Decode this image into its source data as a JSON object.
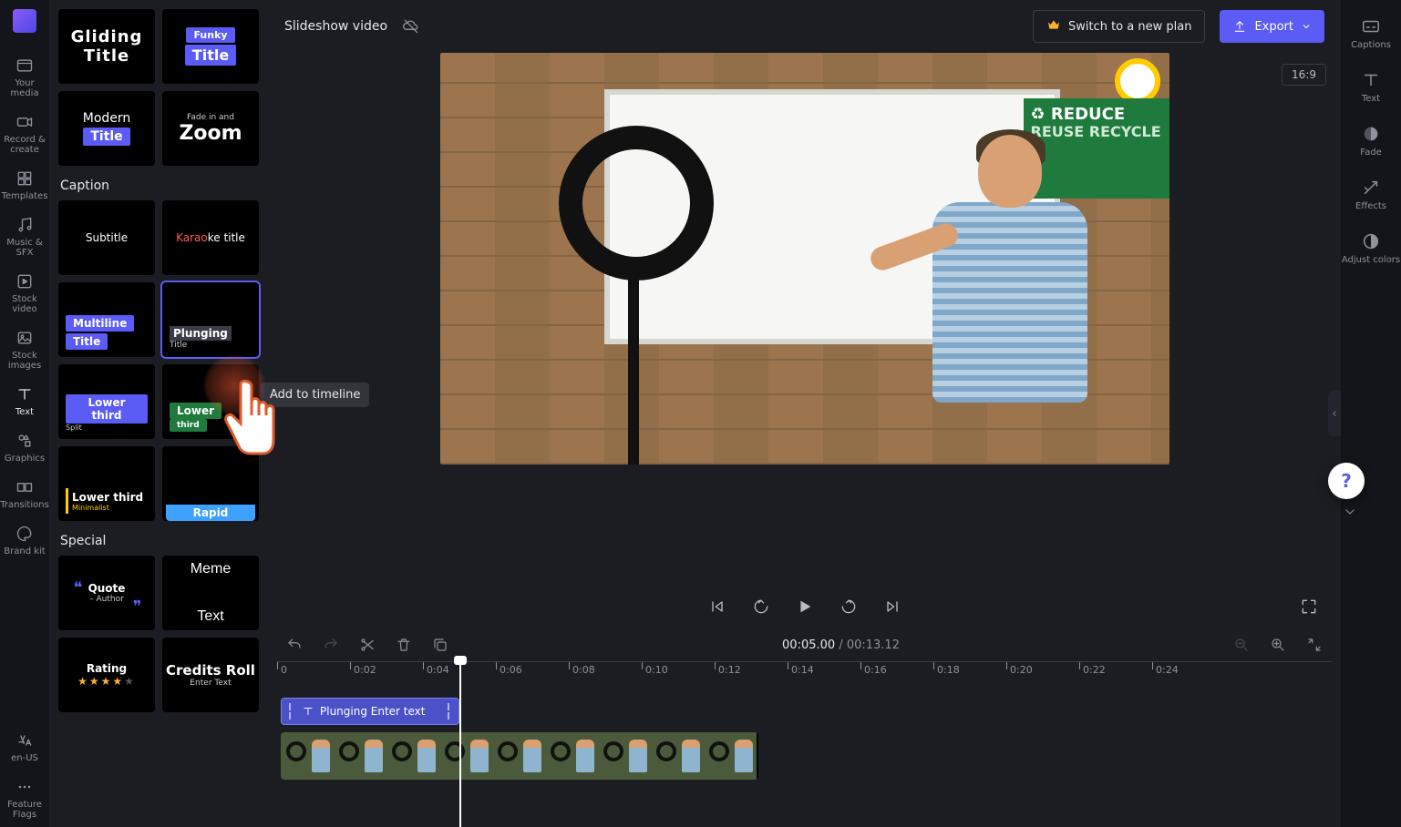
{
  "project_name": "Slideshow video",
  "topbar": {
    "switch_label": "Switch to a new plan",
    "export_label": "Export"
  },
  "aspect_ratio": "16:9",
  "rail": [
    {
      "id": "your-media",
      "label": "Your media"
    },
    {
      "id": "record-create",
      "label": "Record & create"
    },
    {
      "id": "templates",
      "label": "Templates"
    },
    {
      "id": "music-sfx",
      "label": "Music & SFX"
    },
    {
      "id": "stock-video",
      "label": "Stock video"
    },
    {
      "id": "stock-images",
      "label": "Stock images"
    },
    {
      "id": "text",
      "label": "Text",
      "active": true
    },
    {
      "id": "graphics",
      "label": "Graphics"
    },
    {
      "id": "transitions",
      "label": "Transitions"
    },
    {
      "id": "brand-kit",
      "label": "Brand kit"
    }
  ],
  "rail_bottom": [
    {
      "id": "lang",
      "label": "en-US"
    },
    {
      "id": "feature-flags",
      "label": "Feature Flags"
    }
  ],
  "browse": {
    "groups": [
      {
        "id": "titles",
        "header": null,
        "tiles": [
          {
            "id": "gliding-title",
            "line1": "Gliding",
            "line2": "Title",
            "style": "bold"
          },
          {
            "id": "funky-title",
            "tag": "Funky",
            "tag_bg": "#5b5bf5",
            "line2": "Title",
            "line2_bg": "#5b5bf5"
          },
          {
            "id": "modern-title",
            "line1": "Modern",
            "pill": "Title",
            "pill_bg": "#5b5bf5"
          },
          {
            "id": "fade-zoom",
            "small": "Fade in and",
            "big": "Zoom"
          }
        ]
      },
      {
        "id": "caption",
        "header": "Caption",
        "tiles": [
          {
            "id": "subtitle",
            "line1": "Subtitle"
          },
          {
            "id": "karaoke",
            "rich": "<span style='color:#ff5a5a'>Karao</span>ke title"
          },
          {
            "id": "multiline-title",
            "pill1": "Multiline",
            "pill1_bg": "#5b5bf5",
            "pill2": "Title",
            "pill2_bg": "#5b5bf5",
            "align": "left"
          },
          {
            "id": "plunging-title",
            "line1": "Plunging",
            "sub": "Title",
            "align": "left",
            "selected": true
          },
          {
            "id": "lower-third-split",
            "pill": "Lower third",
            "pill_bg": "#5b5bf5",
            "sub": "Split",
            "align": "left"
          },
          {
            "id": "lower-third-green",
            "pill": "Lower",
            "pill_bg": "#1f7a3d",
            "sub": "third",
            "sub_bg": "#1f7a3d",
            "align": "left"
          },
          {
            "id": "lower-third-minimalist",
            "bar": "#ffcc00",
            "line1": "Lower third",
            "sub": "Minimalist",
            "sub_color": "#ffcc00",
            "align": "left"
          },
          {
            "id": "rapid",
            "pill": "Rapid",
            "pill_bg": "#3ea0ff",
            "align": "bottom"
          }
        ]
      },
      {
        "id": "special",
        "header": "Special",
        "tiles": [
          {
            "id": "quote",
            "quote": "Quote",
            "author": "– Author"
          },
          {
            "id": "meme",
            "top": "Meme",
            "bottom": "Text"
          },
          {
            "id": "rating",
            "line1": "Rating",
            "stars": 4
          },
          {
            "id": "credits-roll",
            "line1": "Credits Roll",
            "sub": "Enter Text"
          }
        ]
      }
    ]
  },
  "tooltip": "Add to timeline",
  "player": {
    "current": "00:05.00",
    "duration": "00:13.12"
  },
  "ruler": [
    "0",
    "0:02",
    "0:04",
    "0:06",
    "0:08",
    "0:10",
    "0:12",
    "0:14",
    "0:16",
    "0:18",
    "0:20",
    "0:22",
    "0:24"
  ],
  "text_clip_label": "Plunging Enter text",
  "poster": {
    "l1": "REDUCE",
    "l2": "REUSE RECYCLE"
  },
  "rrail": [
    {
      "id": "captions",
      "label": "Captions"
    },
    {
      "id": "text-props",
      "label": "Text"
    },
    {
      "id": "fade",
      "label": "Fade"
    },
    {
      "id": "effects",
      "label": "Effects"
    },
    {
      "id": "adjust-colors",
      "label": "Adjust colors"
    }
  ]
}
